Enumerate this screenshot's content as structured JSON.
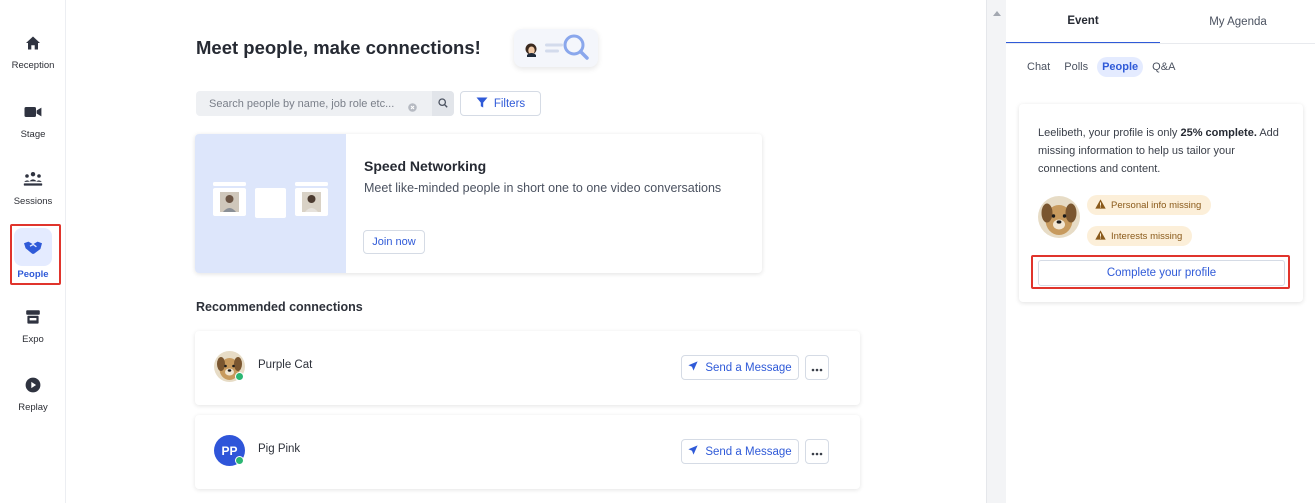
{
  "nav": {
    "items": [
      {
        "label": "Reception",
        "icon": "home-icon"
      },
      {
        "label": "Stage",
        "icon": "video-camera-icon"
      },
      {
        "label": "Sessions",
        "icon": "group-icon"
      },
      {
        "label": "People",
        "icon": "handshake-icon"
      },
      {
        "label": "Expo",
        "icon": "booth-icon"
      },
      {
        "label": "Replay",
        "icon": "play-circle-icon"
      }
    ],
    "active": "People"
  },
  "main": {
    "title": "Meet people, make connections!",
    "search": {
      "placeholder": "Search people by name, job role etc..."
    },
    "filters_label": "Filters",
    "speed_networking": {
      "title": "Speed Networking",
      "description": "Meet like-minded people in short one to one video conversations",
      "button": "Join now"
    },
    "recommended_title": "Recommended connections",
    "connections": [
      {
        "name": "Purple Cat",
        "avatar": "dog-photo",
        "initials": "",
        "online": true,
        "button": "Send a Message"
      },
      {
        "name": "Pig Pink",
        "avatar": "initials",
        "initials": "PP",
        "online": true,
        "button": "Send a Message"
      }
    ]
  },
  "right_panel": {
    "tabs": [
      "Event",
      "My Agenda"
    ],
    "active_tab": "Event",
    "sub_tabs": [
      "Chat",
      "Polls",
      "People",
      "Q&A"
    ],
    "active_sub_tab": "People",
    "profile": {
      "text_before": "Leelibeth, your profile is only ",
      "percent": "25% complete.",
      "text_after": " Add missing information to help us tailor your connections and content.",
      "badges": [
        "Personal info missing",
        "Interests missing"
      ],
      "button": "Complete your profile"
    }
  },
  "colors": {
    "accent": "#2f5ad8",
    "active_bg": "#e4ebff",
    "highlight_outline": "#e0342c",
    "warn_bg": "#fcefd9",
    "online": "#2bb673"
  }
}
